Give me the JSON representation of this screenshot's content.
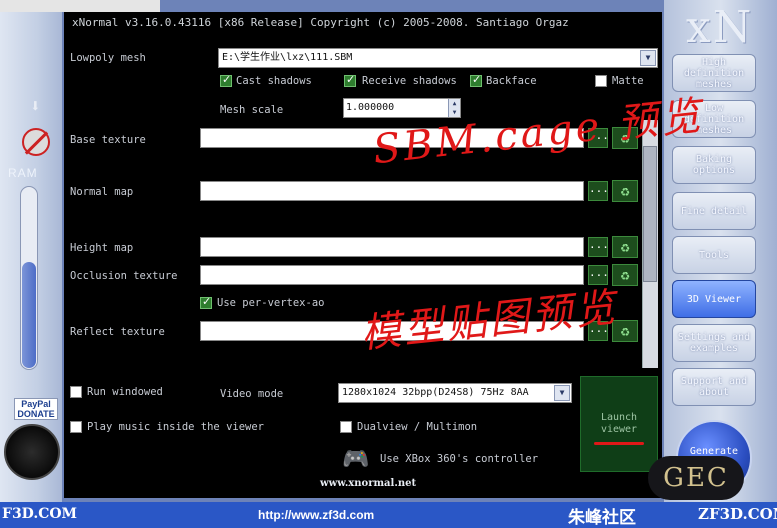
{
  "window": {
    "title": "xNormal v3.16.0.43116 [x86 Release] Copyright (c) 2005-2008. Santiago Orgaz"
  },
  "logo": "xN",
  "form": {
    "lowpoly_label": "Lowpoly mesh",
    "lowpoly_value": "E:\\学生作业\\lxz\\111.SBM",
    "cast_shadows": "Cast shadows",
    "receive_shadows": "Receive shadows",
    "backface": "Backface",
    "matte": "Matte",
    "mesh_scale_label": "Mesh scale",
    "mesh_scale_value": "1.000000",
    "base_texture": "Base texture",
    "normal_map": "Normal map",
    "height_map": "Height map",
    "occlusion_texture": "Occlusion texture",
    "use_per_vertex_ao": "Use per-vertex-ao",
    "reflect_texture": "Reflect texture",
    "dots": "..."
  },
  "viewer": {
    "run_windowed": "Run windowed",
    "video_mode_label": "Video mode",
    "video_mode_value": "1280x1024 32bpp(D24S8) 75Hz 8AA",
    "play_music": "Play music inside the viewer",
    "dualview": "Dualview / Multimon",
    "xbox": "Use XBox 360's controller",
    "launch": "Launch viewer",
    "website": "www.xnormal.net"
  },
  "nav": {
    "high": "High definition meshes",
    "low": "Low definition meshes",
    "baking": "Baking options",
    "fine": "Fine detail",
    "tools": "Tools",
    "viewer3d": "3D Viewer",
    "settings": "Settings and examples",
    "support": "Support and about",
    "generate": "Generate"
  },
  "sidebar": {
    "ram": "RAM",
    "paypal": "PayPal DONATE"
  },
  "annotations": {
    "top": "SBM.cage 预览",
    "middle": "模型贴图预览"
  },
  "watermarks": {
    "left": "F3D.COM",
    "url": "http://www.zf3d.com",
    "community": "朱峰社区",
    "right": "ZF3D.COM",
    "gec": "GEC"
  },
  "colors": {
    "panel": "#000000",
    "active_nav": "#3f6ee6",
    "button_green": "#1d4d1d"
  }
}
